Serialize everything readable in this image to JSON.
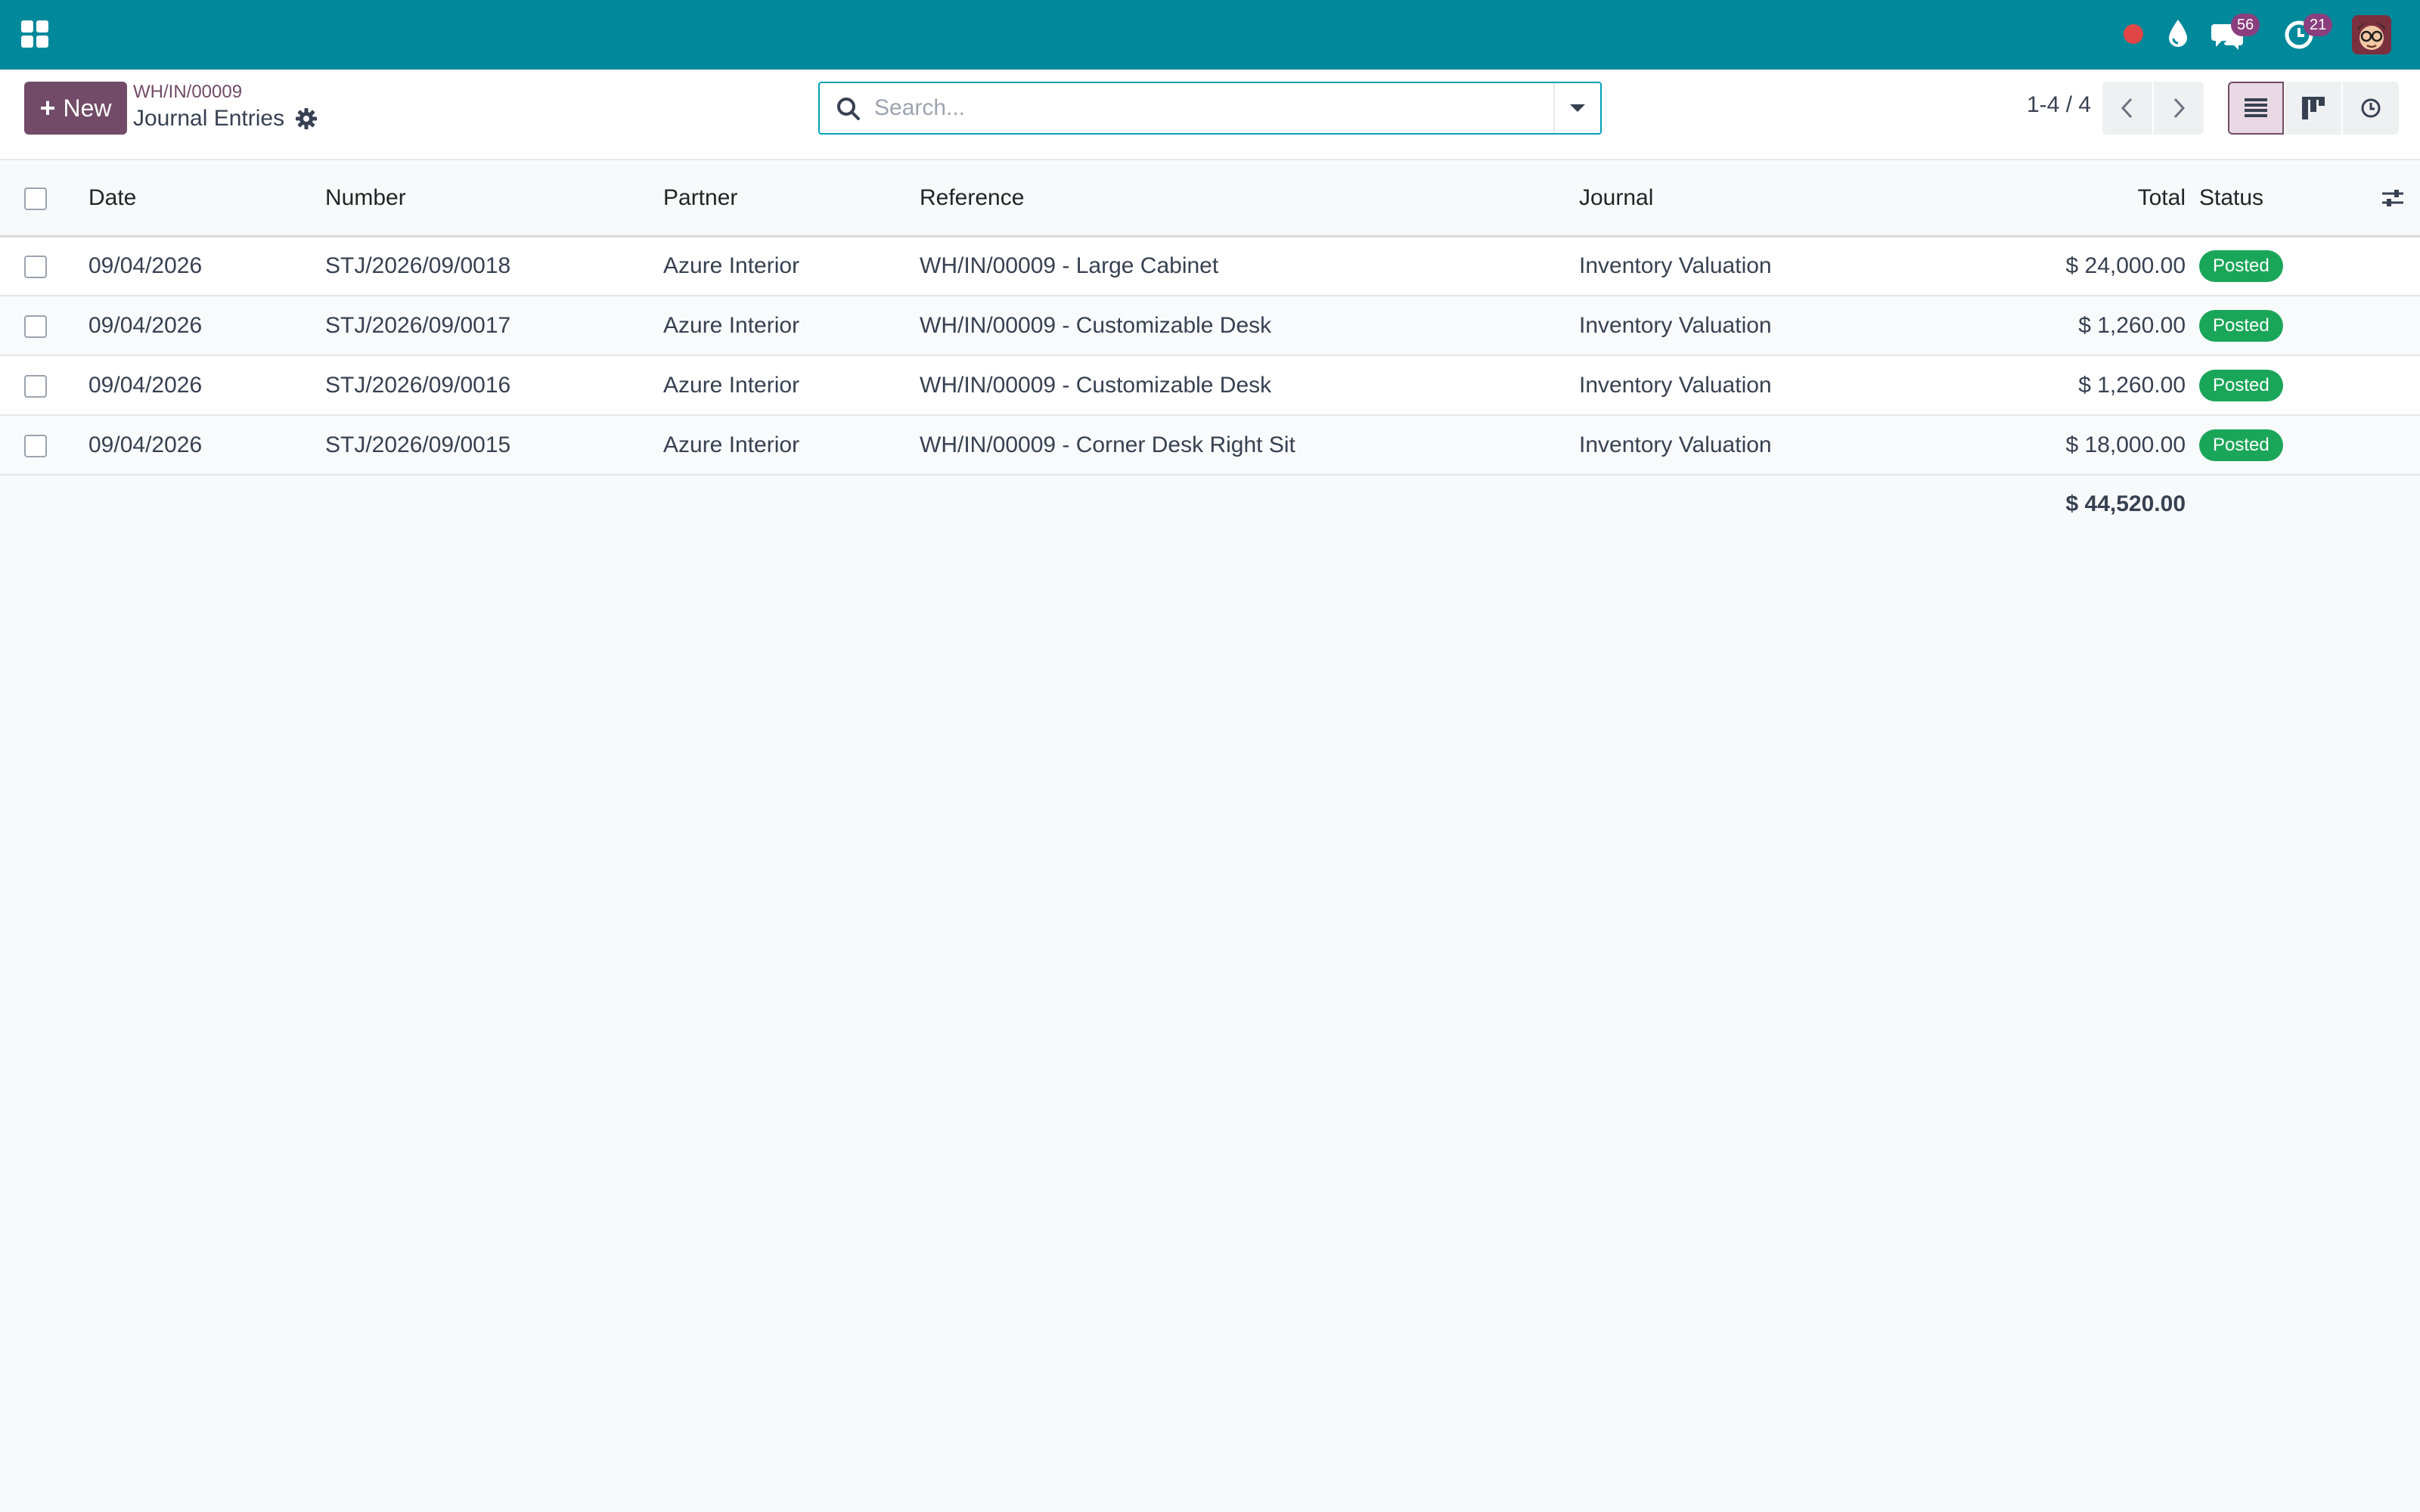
{
  "navbar": {
    "apps_icon": "apps-grid-icon",
    "messages_badge": "56",
    "activities_badge": "21"
  },
  "control_panel": {
    "new_button": "New",
    "breadcrumb_parent": "WH/IN/00009",
    "title": "Journal Entries",
    "search_placeholder": "Search...",
    "pager": "1-4 / 4"
  },
  "table": {
    "headers": {
      "date": "Date",
      "number": "Number",
      "partner": "Partner",
      "reference": "Reference",
      "journal": "Journal",
      "total": "Total",
      "status": "Status"
    },
    "rows": [
      {
        "date": "09/04/2026",
        "number": "STJ/2026/09/0018",
        "partner": "Azure Interior",
        "reference": "WH/IN/00009 - Large Cabinet",
        "journal": "Inventory Valuation",
        "total": "$ 24,000.00",
        "status": "Posted"
      },
      {
        "date": "09/04/2026",
        "number": "STJ/2026/09/0017",
        "partner": "Azure Interior",
        "reference": "WH/IN/00009 - Customizable Desk",
        "journal": "Inventory Valuation",
        "total": "$ 1,260.00",
        "status": "Posted"
      },
      {
        "date": "09/04/2026",
        "number": "STJ/2026/09/0016",
        "partner": "Azure Interior",
        "reference": "WH/IN/00009 - Customizable Desk",
        "journal": "Inventory Valuation",
        "total": "$ 1,260.00",
        "status": "Posted"
      },
      {
        "date": "09/04/2026",
        "number": "STJ/2026/09/0015",
        "partner": "Azure Interior",
        "reference": "WH/IN/00009 - Corner Desk Right Sit",
        "journal": "Inventory Valuation",
        "total": "$ 18,000.00",
        "status": "Posted"
      }
    ],
    "sum_total": "$ 44,520.00"
  },
  "colors": {
    "navbar": "#00899b",
    "primary": "#714b67",
    "posted": "#1aa659",
    "badge": "#8a3e7e"
  }
}
